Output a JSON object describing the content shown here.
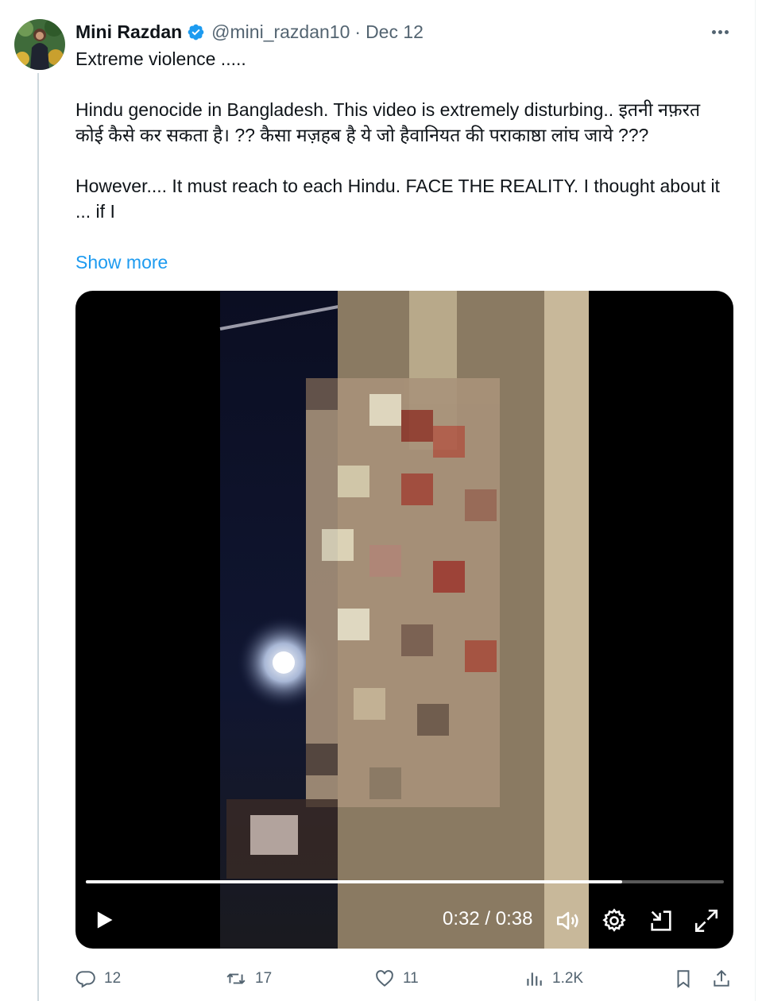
{
  "tweet": {
    "author_name": "Mini Razdan",
    "handle": "@mini_razdan10",
    "separator": "·",
    "date": "Dec 12",
    "lines": [
      "Extreme violence .....",
      "Hindu genocide in Bangladesh.   This video is extremely disturbing.. इतनी नफ़रत कोई कैसे कर सकता है। ??  कैसा मज़हब है ये जो हैवानियत की पराकाष्ठा लांघ जाये ???",
      "However.... It must reach to each Hindu.  FACE THE REALITY.   I thought about it ... if I"
    ],
    "show_more": "Show more"
  },
  "video": {
    "current_time": "0:32",
    "duration": "0:38",
    "time_separator": "/",
    "progress_fraction": 0.84,
    "content_blurred": true
  },
  "actions": {
    "replies": "12",
    "reposts": "17",
    "likes": "11",
    "views": "1.2K"
  },
  "icons": {
    "verified": "verified-badge-icon",
    "more": "more-horizontal-icon",
    "play": "play-icon",
    "volume": "volume-icon",
    "settings": "gear-icon",
    "dock": "picture-in-picture-icon",
    "fullscreen": "fullscreen-icon",
    "reply": "reply-icon",
    "repost": "repost-icon",
    "like": "heart-icon",
    "views": "views-chart-icon",
    "bookmark": "bookmark-icon",
    "share": "share-icon"
  },
  "colors": {
    "accent": "#1d9bf0",
    "text_primary": "#0f1419",
    "text_secondary": "#536471"
  }
}
